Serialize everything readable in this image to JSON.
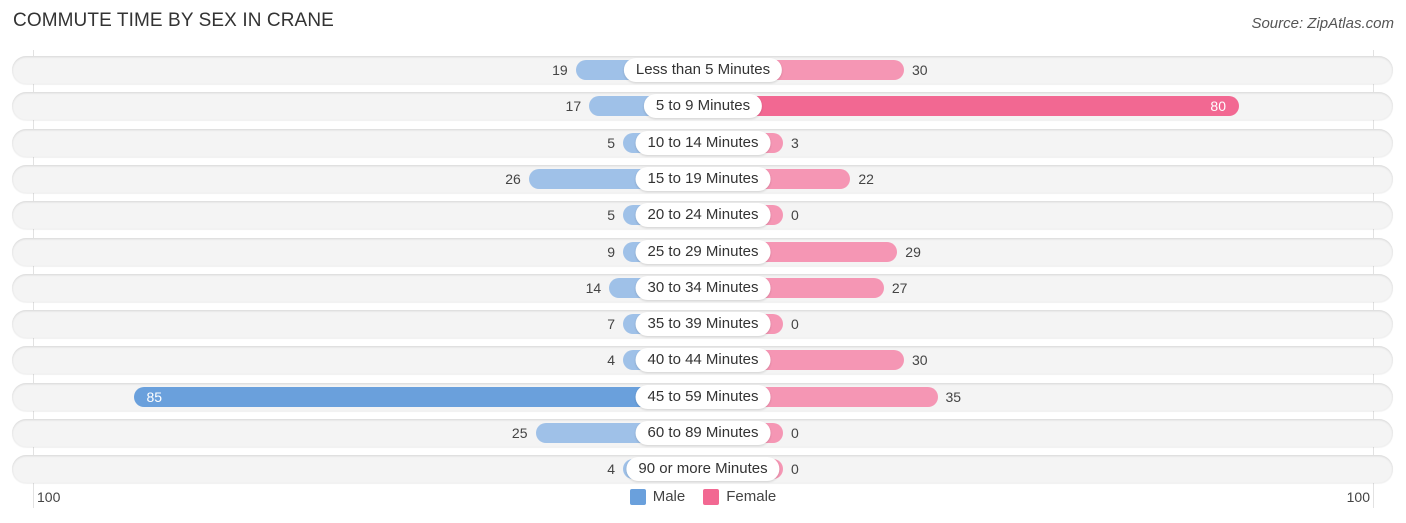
{
  "header": {
    "title": "COMMUTE TIME BY SEX IN CRANE",
    "source": "Source: ZipAtlas.com"
  },
  "colors": {
    "male": "#9fc1e8",
    "male_strong": "#6aa0dc",
    "female": "#f596b4",
    "female_strong": "#f26892"
  },
  "chart_data": {
    "type": "bar",
    "orientation": "horizontal-diverging",
    "title": "COMMUTE TIME BY SEX IN CRANE",
    "categories": [
      "Less than 5 Minutes",
      "5 to 9 Minutes",
      "10 to 14 Minutes",
      "15 to 19 Minutes",
      "20 to 24 Minutes",
      "25 to 29 Minutes",
      "30 to 34 Minutes",
      "35 to 39 Minutes",
      "40 to 44 Minutes",
      "45 to 59 Minutes",
      "60 to 89 Minutes",
      "90 or more Minutes"
    ],
    "series": [
      {
        "name": "Male",
        "values": [
          19,
          17,
          5,
          26,
          5,
          9,
          14,
          7,
          4,
          85,
          25,
          4
        ]
      },
      {
        "name": "Female",
        "values": [
          30,
          80,
          3,
          22,
          0,
          29,
          27,
          0,
          30,
          35,
          0,
          0
        ]
      }
    ],
    "xlim": [
      -100,
      100
    ],
    "axis_ticks": {
      "left": "100",
      "right": "100"
    },
    "legend": {
      "position": "bottom-center",
      "entries": [
        "Male",
        "Female"
      ]
    },
    "grid": false
  }
}
